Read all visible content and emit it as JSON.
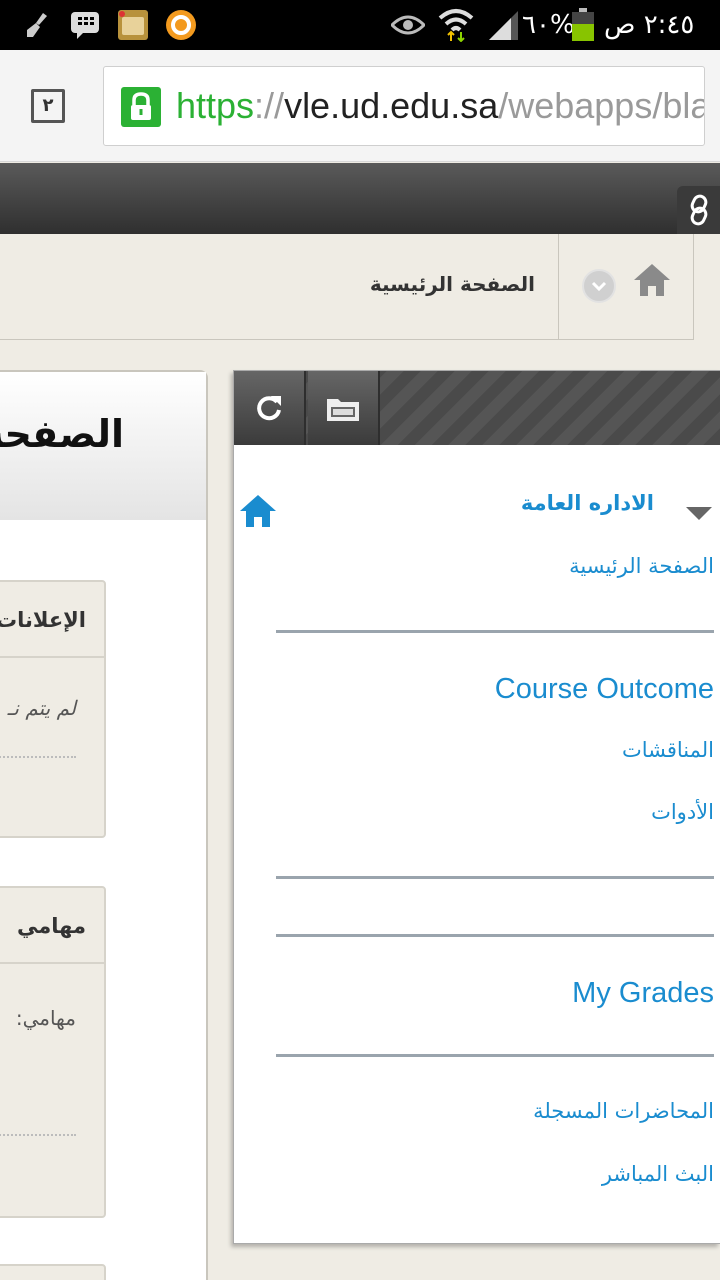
{
  "status_bar": {
    "time": "٢:٤٥ ص",
    "battery": "٦٠%",
    "notification_icons": [
      "broom-icon",
      "bbm-icon",
      "calendar-app-icon",
      "orange-circle-icon"
    ],
    "system_icons": [
      "eye-icon",
      "wifi-icon",
      "signal-icon",
      "battery-icon"
    ]
  },
  "browser": {
    "tab_count": "٢",
    "url_scheme": "https",
    "url_separator": "://",
    "url_host": "vle.ud.edu.sa",
    "url_path": "/webapps/bla",
    "colors": {
      "secure": "#2bb134"
    }
  },
  "breadcrumb": {
    "title": "الصفحة الرئيسية"
  },
  "content": {
    "page_title": "الصفحة",
    "modules": [
      {
        "title": "الإعلانات",
        "body": "لم يتم نـ"
      },
      {
        "title": "مهامي",
        "body": "مهامي:"
      }
    ]
  },
  "nav": {
    "section_header": "الاداره العامة",
    "items": [
      {
        "label": "الصفحة الرئيسية"
      },
      {
        "label": "Course Outcome"
      },
      {
        "label": "المناقشات"
      },
      {
        "label": "الأدوات"
      },
      {
        "label": "My Grades"
      },
      {
        "label": "المحاضرات المسجلة"
      },
      {
        "label": "البث المباشر"
      }
    ],
    "colors": {
      "link": "#1a8ccf"
    }
  }
}
